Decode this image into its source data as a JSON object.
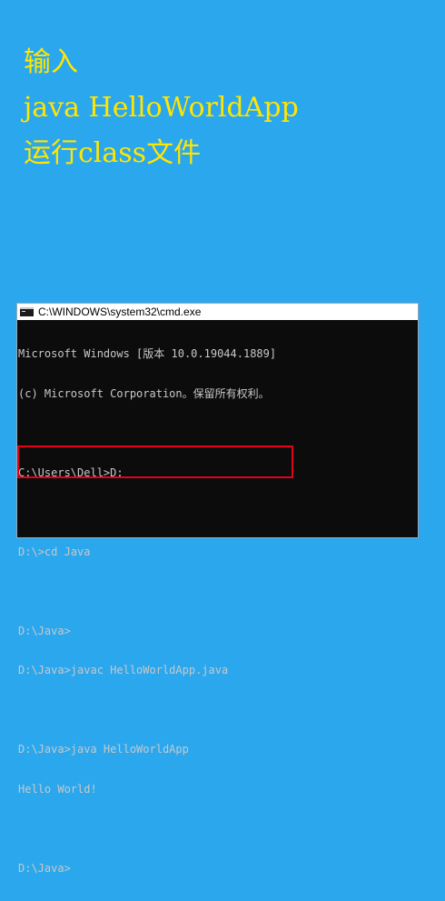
{
  "heading": {
    "line1": "输入",
    "line2": "java HelloWorldApp",
    "line3": "运行class文件"
  },
  "colors": {
    "background": "#2ba7ee",
    "heading_text": "#ffe600",
    "console_background": "#0c0c0c",
    "console_text": "#c8c8c8",
    "highlight_border": "#e3001b"
  },
  "cmd_window": {
    "title": "C:\\WINDOWS\\system32\\cmd.exe",
    "icon": "cmd-icon",
    "lines": [
      "Microsoft Windows [版本 10.0.19044.1889]",
      "(c) Microsoft Corporation。保留所有权利。",
      "",
      "C:\\Users\\Dell>D:",
      "",
      "D:\\>cd Java",
      "",
      "D:\\Java>",
      "D:\\Java>javac HelloWorldApp.java",
      "",
      "D:\\Java>java HelloWorldApp",
      "Hello World!",
      "",
      "D:\\Java>"
    ]
  }
}
